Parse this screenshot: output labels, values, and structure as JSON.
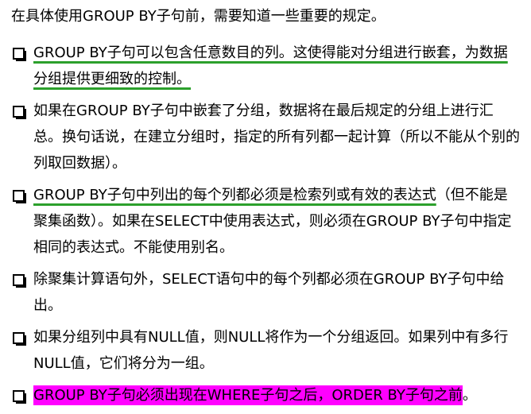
{
  "intro": "在具体使用GROUP BY子句前，需要知道一些重要的规定。",
  "rules": [
    {
      "text": "GROUP BY子句可以包含任意数目的列。这使得能对分组进行嵌套，为数据分组提供更细致的控制。",
      "emphasis": "green-underline"
    },
    {
      "text": "如果在GROUP BY子句中嵌套了分组，数据将在最后规定的分组上进行汇总。换句话说，在建立分组时，指定的所有列都一起计算（所以不能从个别的列取回数据）。",
      "emphasis": "none"
    },
    {
      "lead": "GROUP BY子句中列出的每个列都必须是检索列或有效的表达式",
      "rest": "（但不能是聚集函数）。如果在SELECT中使用表达式，则必须在GROUP BY子句中指定相同的表达式。不能使用别名。",
      "emphasis": "green-underline-lead"
    },
    {
      "text": "除聚集计算语句外，SELECT语句中的每个列都必须在GROUP BY子句中给出。",
      "emphasis": "none"
    },
    {
      "text": "如果分组列中具有NULL值，则NULL将作为一个分组返回。如果列中有多行NULL值，它们将分为一组。",
      "emphasis": "none"
    },
    {
      "lead": "GROUP BY子句必须出现在WHERE子句之后，ORDER BY子句之前",
      "rest": "。",
      "emphasis": "magenta-highlight-lead"
    }
  ],
  "colors": {
    "underline": "#2ca02c",
    "highlight": "#ff00ff",
    "text": "#000000",
    "background": "#ffffff"
  },
  "icons": {
    "bullet": "checkbox-square-bullet-icon"
  }
}
